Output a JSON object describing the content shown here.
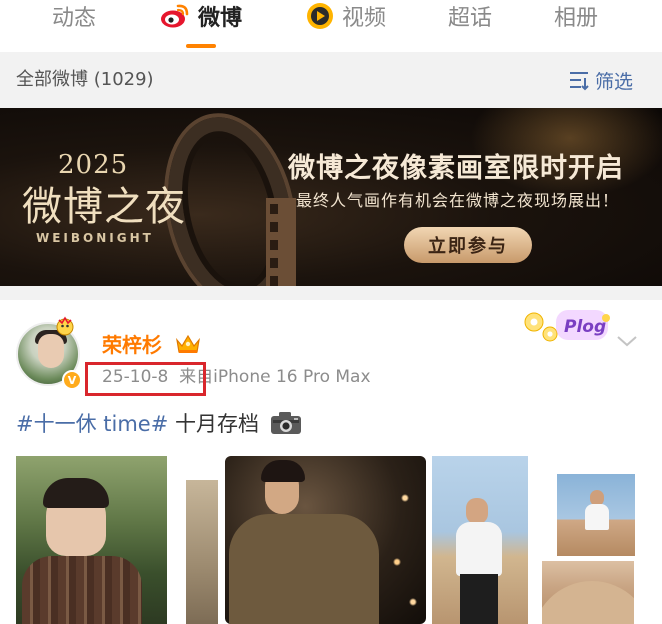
{
  "tabs": [
    {
      "label": "动态",
      "active": false
    },
    {
      "label": "微博",
      "active": true
    },
    {
      "label": "视频",
      "active": false
    },
    {
      "label": "超话",
      "active": false
    },
    {
      "label": "相册",
      "active": false
    }
  ],
  "accent_color": "#ff8200",
  "filter": {
    "count_label": "全部微博 (1029)",
    "filter_label": "筛选"
  },
  "banner": {
    "logo_year": "2025",
    "logo_cn": "微博之夜",
    "logo_en": "WEIBONIGHT",
    "title": "微博之夜像素画室限时开启",
    "subtitle": "最终人气画作有机会在微博之夜现场展出！",
    "button_label": "立即参与"
  },
  "post": {
    "username": "荣梓杉",
    "username_color": "#ff7a00",
    "date": "25-10-8",
    "source": "来自iPhone 16 Pro Max",
    "topic": "#十一休 time#",
    "text": "十月存档",
    "sticker_text": "Plog",
    "icons": [
      "crown-icon",
      "verified-icon",
      "camera-icon",
      "chevron-down-icon"
    ]
  }
}
